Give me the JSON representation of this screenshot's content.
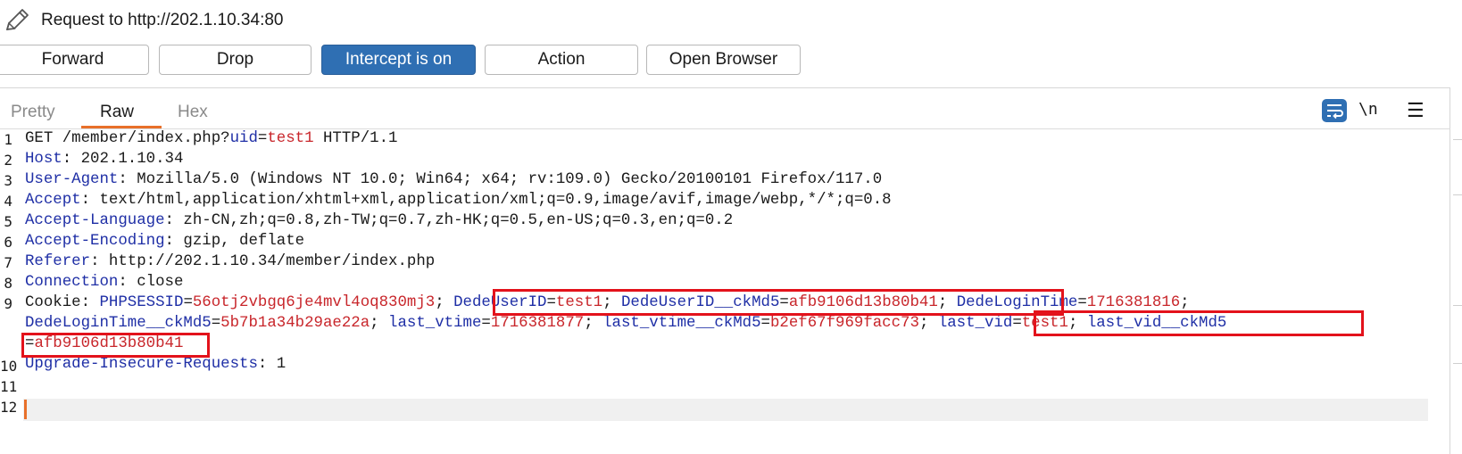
{
  "titlebar": {
    "title": "Request to http://202.1.10.34:80",
    "icon": "pencil-icon"
  },
  "toolbar": {
    "forward": "Forward",
    "drop": "Drop",
    "intercept": "Intercept is on",
    "action": "Action",
    "open_browser": "Open Browser"
  },
  "tabs": [
    "Pretty",
    "Raw",
    "Hex"
  ],
  "selected_tab": "Raw",
  "editor_icons": {
    "wrap": "wrap-lines-icon",
    "newline": "\\n",
    "menu": "hamburger-menu-icon"
  },
  "colors": {
    "accent": "#2f6fb3",
    "key": "#1f2fa6",
    "value": "#c8262b",
    "highlight": "#e3121b",
    "caret": "#e8702a"
  },
  "editor": {
    "line_numbers": [
      "1",
      "2",
      "3",
      "4",
      "5",
      "6",
      "7",
      "8",
      "9",
      "10",
      "11",
      "12"
    ],
    "line1": {
      "method": "GET /member/index.php?",
      "param": "uid",
      "eq": "=",
      "value": "test1",
      "proto": " HTTP/1.1"
    },
    "line2": {
      "key": "Host",
      "value": ": 202.1.10.34"
    },
    "line3": {
      "key": "User-Agent",
      "value": ": Mozilla/5.0 (Windows NT 10.0; Win64; x64; rv:109.0) Gecko/20100101 Firefox/117.0"
    },
    "line4": {
      "key": "Accept",
      "value": ": text/html,application/xhtml+xml,application/xml;q=0.9,image/avif,image/webp,*/*;q=0.8"
    },
    "line5": {
      "key": "Accept-Language",
      "value": ": zh-CN,zh;q=0.8,zh-TW;q=0.7,zh-HK;q=0.5,en-US;q=0.3,en;q=0.2"
    },
    "line6": {
      "key": "Accept-Encoding",
      "value": ": gzip, deflate"
    },
    "line7": {
      "key": "Referer",
      "value": ": http://202.1.10.34/member/index.php"
    },
    "line8": {
      "key": "Connection",
      "value": ": close"
    },
    "line9_cookie_label": "Cookie: ",
    "cookies": [
      {
        "name": "PHPSESSID",
        "value": "56otj2vbgq6je4mvl4oq830mj3"
      },
      {
        "name": "DedeUserID",
        "value": "test1"
      },
      {
        "name": "DedeUserID__ckMd5",
        "value": "afb9106d13b80b41"
      },
      {
        "name": "DedeLoginTime",
        "value": "1716381816"
      },
      {
        "name": "DedeLoginTime__ckMd5",
        "value": "5b7b1a34b29ae22a"
      },
      {
        "name": "last_vtime",
        "value": "1716381877"
      },
      {
        "name": "last_vtime__ckMd5",
        "value": "b2ef67f969facc73"
      },
      {
        "name": "last_vid",
        "value": "test1"
      },
      {
        "name": "last_vid__ckMd5",
        "value": "afb9106d13b80b41"
      }
    ],
    "line10": {
      "key": "Upgrade-Insecure-Requests",
      "value": ": 1"
    }
  }
}
